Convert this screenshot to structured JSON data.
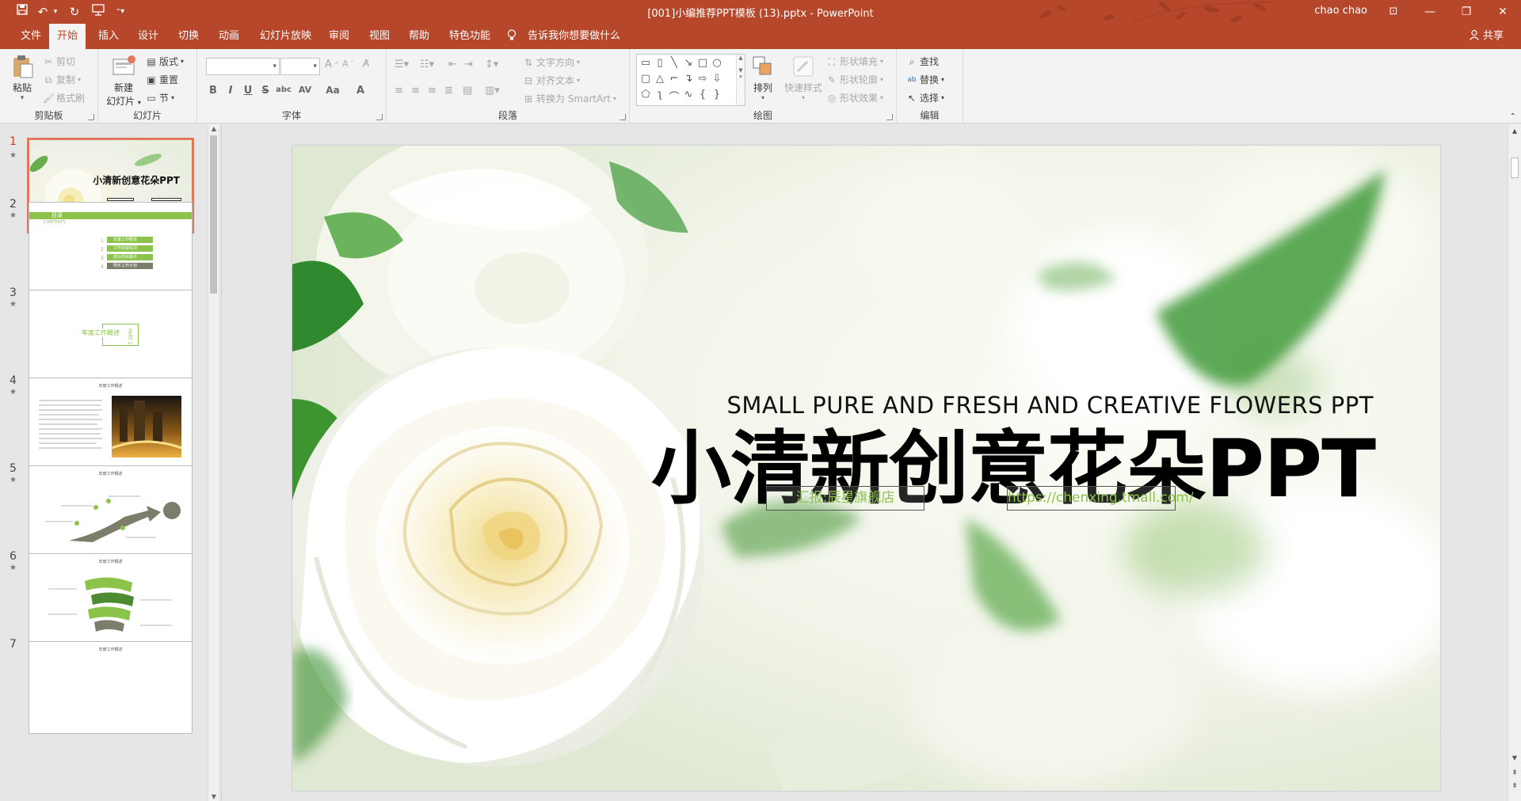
{
  "titlebar": {
    "doc_title": "[001]小编推荐PPT模板 (13).pptx  -  PowerPoint",
    "user": "chao chao",
    "qa_icons": [
      "save-icon",
      "undo-icon",
      "redo-icon",
      "present-from-start-icon",
      "customize-qat-icon"
    ],
    "win_minimize": "—",
    "win_restore": "❐",
    "win_close": "✕",
    "ribbon_display": "⊡"
  },
  "tabs": [
    {
      "label": "文件",
      "active": false
    },
    {
      "label": "开始",
      "active": true
    },
    {
      "label": "插入",
      "active": false
    },
    {
      "label": "设计",
      "active": false
    },
    {
      "label": "切换",
      "active": false
    },
    {
      "label": "动画",
      "active": false
    },
    {
      "label": "幻灯片放映",
      "active": false
    },
    {
      "label": "审阅",
      "active": false
    },
    {
      "label": "视图",
      "active": false
    },
    {
      "label": "帮助",
      "active": false
    },
    {
      "label": "特色功能",
      "active": false
    }
  ],
  "tell_me": "告诉我你想要做什么",
  "share": "共享",
  "ribbon": {
    "clipboard": {
      "label": "剪贴板",
      "paste": "粘贴",
      "cut": "剪切",
      "copy": "复制",
      "format_painter": "格式刷"
    },
    "slides": {
      "label": "幻灯片",
      "new_slide_line1": "新建",
      "new_slide_line2": "幻灯片",
      "layout": "版式",
      "reset": "重置",
      "section": "节"
    },
    "font": {
      "label": "字体",
      "bold": "B",
      "italic": "I",
      "underline": "U",
      "strike": "S",
      "shadow": "abc",
      "spacing": "AV",
      "case": "Aa",
      "color": "A"
    },
    "paragraph": {
      "label": "段落",
      "text_direction": "文字方向",
      "align_text": "对齐文本",
      "smartart": "转换为 SmartArt"
    },
    "drawing": {
      "label": "绘图",
      "arrange": "排列",
      "quick_styles": "快速样式",
      "shape_fill": "形状填充",
      "shape_outline": "形状轮廓",
      "shape_effects": "形状效果"
    },
    "editing": {
      "label": "编辑",
      "find": "查找",
      "replace": "替换",
      "select": "选择"
    }
  },
  "thumbnails": [
    {
      "num": "1",
      "active": true,
      "title": "小清新创意花朵PPT"
    },
    {
      "num": "2",
      "active": false,
      "title": "目录",
      "subtitle": "CONTENTS",
      "items": [
        "年度工作概述",
        "工作完成情况",
        "成功项目展示",
        "明年工作计划"
      ],
      "indices": [
        "1",
        "2",
        "3",
        "4"
      ]
    },
    {
      "num": "3",
      "active": false,
      "title": "年度工作概述",
      "part": "PART 1"
    },
    {
      "num": "4",
      "active": false,
      "title": "年度工作概述"
    },
    {
      "num": "5",
      "active": false,
      "title": "年度工作概述"
    },
    {
      "num": "6",
      "active": false,
      "title": "年度工作概述"
    },
    {
      "num": "7",
      "active": false,
      "title": "年度工作概述"
    }
  ],
  "slide": {
    "en_subtitle": "SMALL PURE AND FRESH AND CREATIVE FLOWERS PPT",
    "cn_title": "小清新创意花朵PPT",
    "reporter": "汇报:辰星旗舰店",
    "url": "https://chenxing.tmall.com/",
    "accent_green": "#8cc34a"
  },
  "colors": {
    "brand": "#b7472a",
    "ribbon_bg": "#f3f3f3",
    "selected_thumb": "#e2785b"
  }
}
